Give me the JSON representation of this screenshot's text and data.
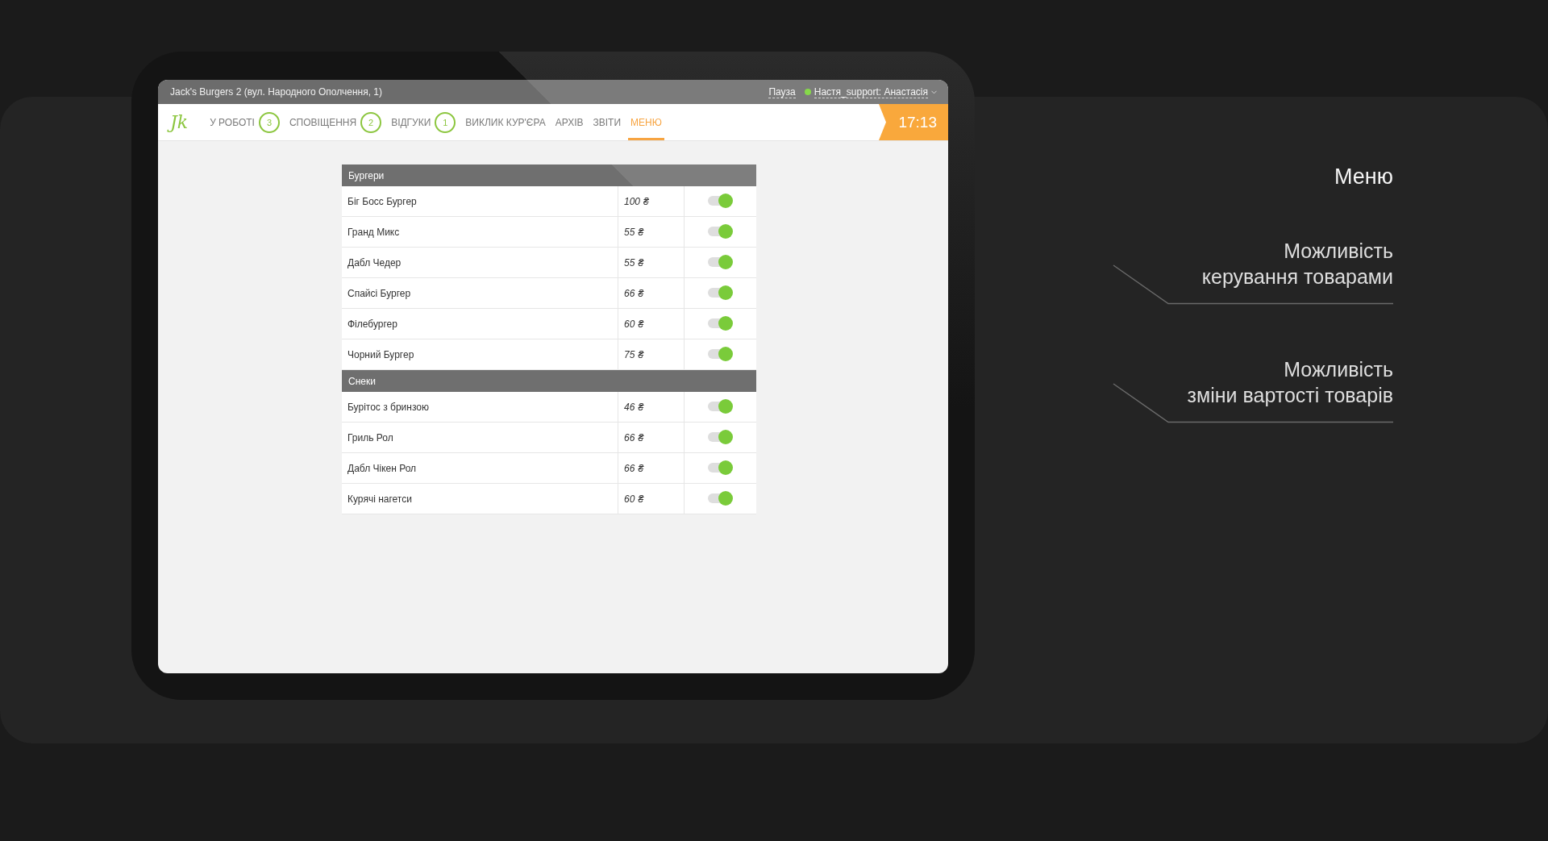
{
  "window": {
    "title": "Jack's Burgers 2 (вул. Народного Ополчення, 1)",
    "pause": "Пауза",
    "user": {
      "name": "Настя_support: Анастасія",
      "online": true
    }
  },
  "nav": {
    "logo": "Jk",
    "tabs": [
      {
        "label": "У РОБОТІ",
        "count": "3",
        "selected": false
      },
      {
        "label": "СПОВІЩЕННЯ",
        "count": "2",
        "selected": false
      },
      {
        "label": "ВІДГУКИ",
        "count": "1",
        "selected": false
      },
      {
        "label": "ВИКЛИК КУР'ЄРА",
        "selected": false
      },
      {
        "label": "АРХІВ",
        "selected": false
      },
      {
        "label": "ЗВІТИ",
        "selected": false
      },
      {
        "label": "МЕНЮ",
        "selected": true
      }
    ],
    "time": "17:13"
  },
  "menu": {
    "groups": [
      {
        "name": "Бургери",
        "items": [
          {
            "name": "Біг Босс Бургер",
            "price": "100 ₴",
            "on": true
          },
          {
            "name": "Гранд Микс",
            "price": "55 ₴",
            "on": true
          },
          {
            "name": "Дабл Чедер",
            "price": "55 ₴",
            "on": true
          },
          {
            "name": "Спайсі Бургер",
            "price": "66 ₴",
            "on": true
          },
          {
            "name": "Філебургер",
            "price": "60 ₴",
            "on": true
          },
          {
            "name": "Чорний Бургер",
            "price": "75 ₴",
            "on": true
          }
        ]
      },
      {
        "name": "Снеки",
        "items": [
          {
            "name": "Бурітос з бринзою",
            "price": "46 ₴",
            "on": true
          },
          {
            "name": "Гриль Рол",
            "price": "66 ₴",
            "on": true
          },
          {
            "name": "Дабл Чікен Рол",
            "price": "66 ₴",
            "on": true
          },
          {
            "name": "Курячі нагетси",
            "price": "60 ₴",
            "on": true
          }
        ]
      }
    ]
  },
  "annotations": {
    "title": "Меню",
    "notes": [
      {
        "lines": [
          "Можливість",
          "керування товарами"
        ]
      },
      {
        "lines": [
          "Можливість",
          "зміни вартості товарів"
        ]
      }
    ]
  }
}
